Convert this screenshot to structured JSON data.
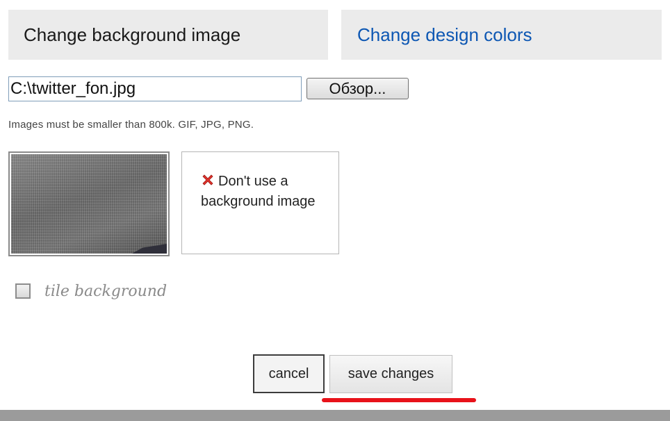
{
  "tabs": {
    "background_image": "Change background image",
    "design_colors": "Change design colors"
  },
  "upload": {
    "file_value": "C:\\twitter_fon.jpg",
    "browse_label": "Обзор...",
    "hint": "Images must be smaller than 800k. GIF, JPG, PNG."
  },
  "no_background": {
    "icon": "red-x-icon",
    "label": "Don't use a background image"
  },
  "tile": {
    "label": "tile background",
    "checked": false
  },
  "actions": {
    "cancel_label": "cancel",
    "save_label": "save changes"
  },
  "colors": {
    "accent_link": "#0d57b3",
    "highlight_underline": "#e8121a"
  }
}
